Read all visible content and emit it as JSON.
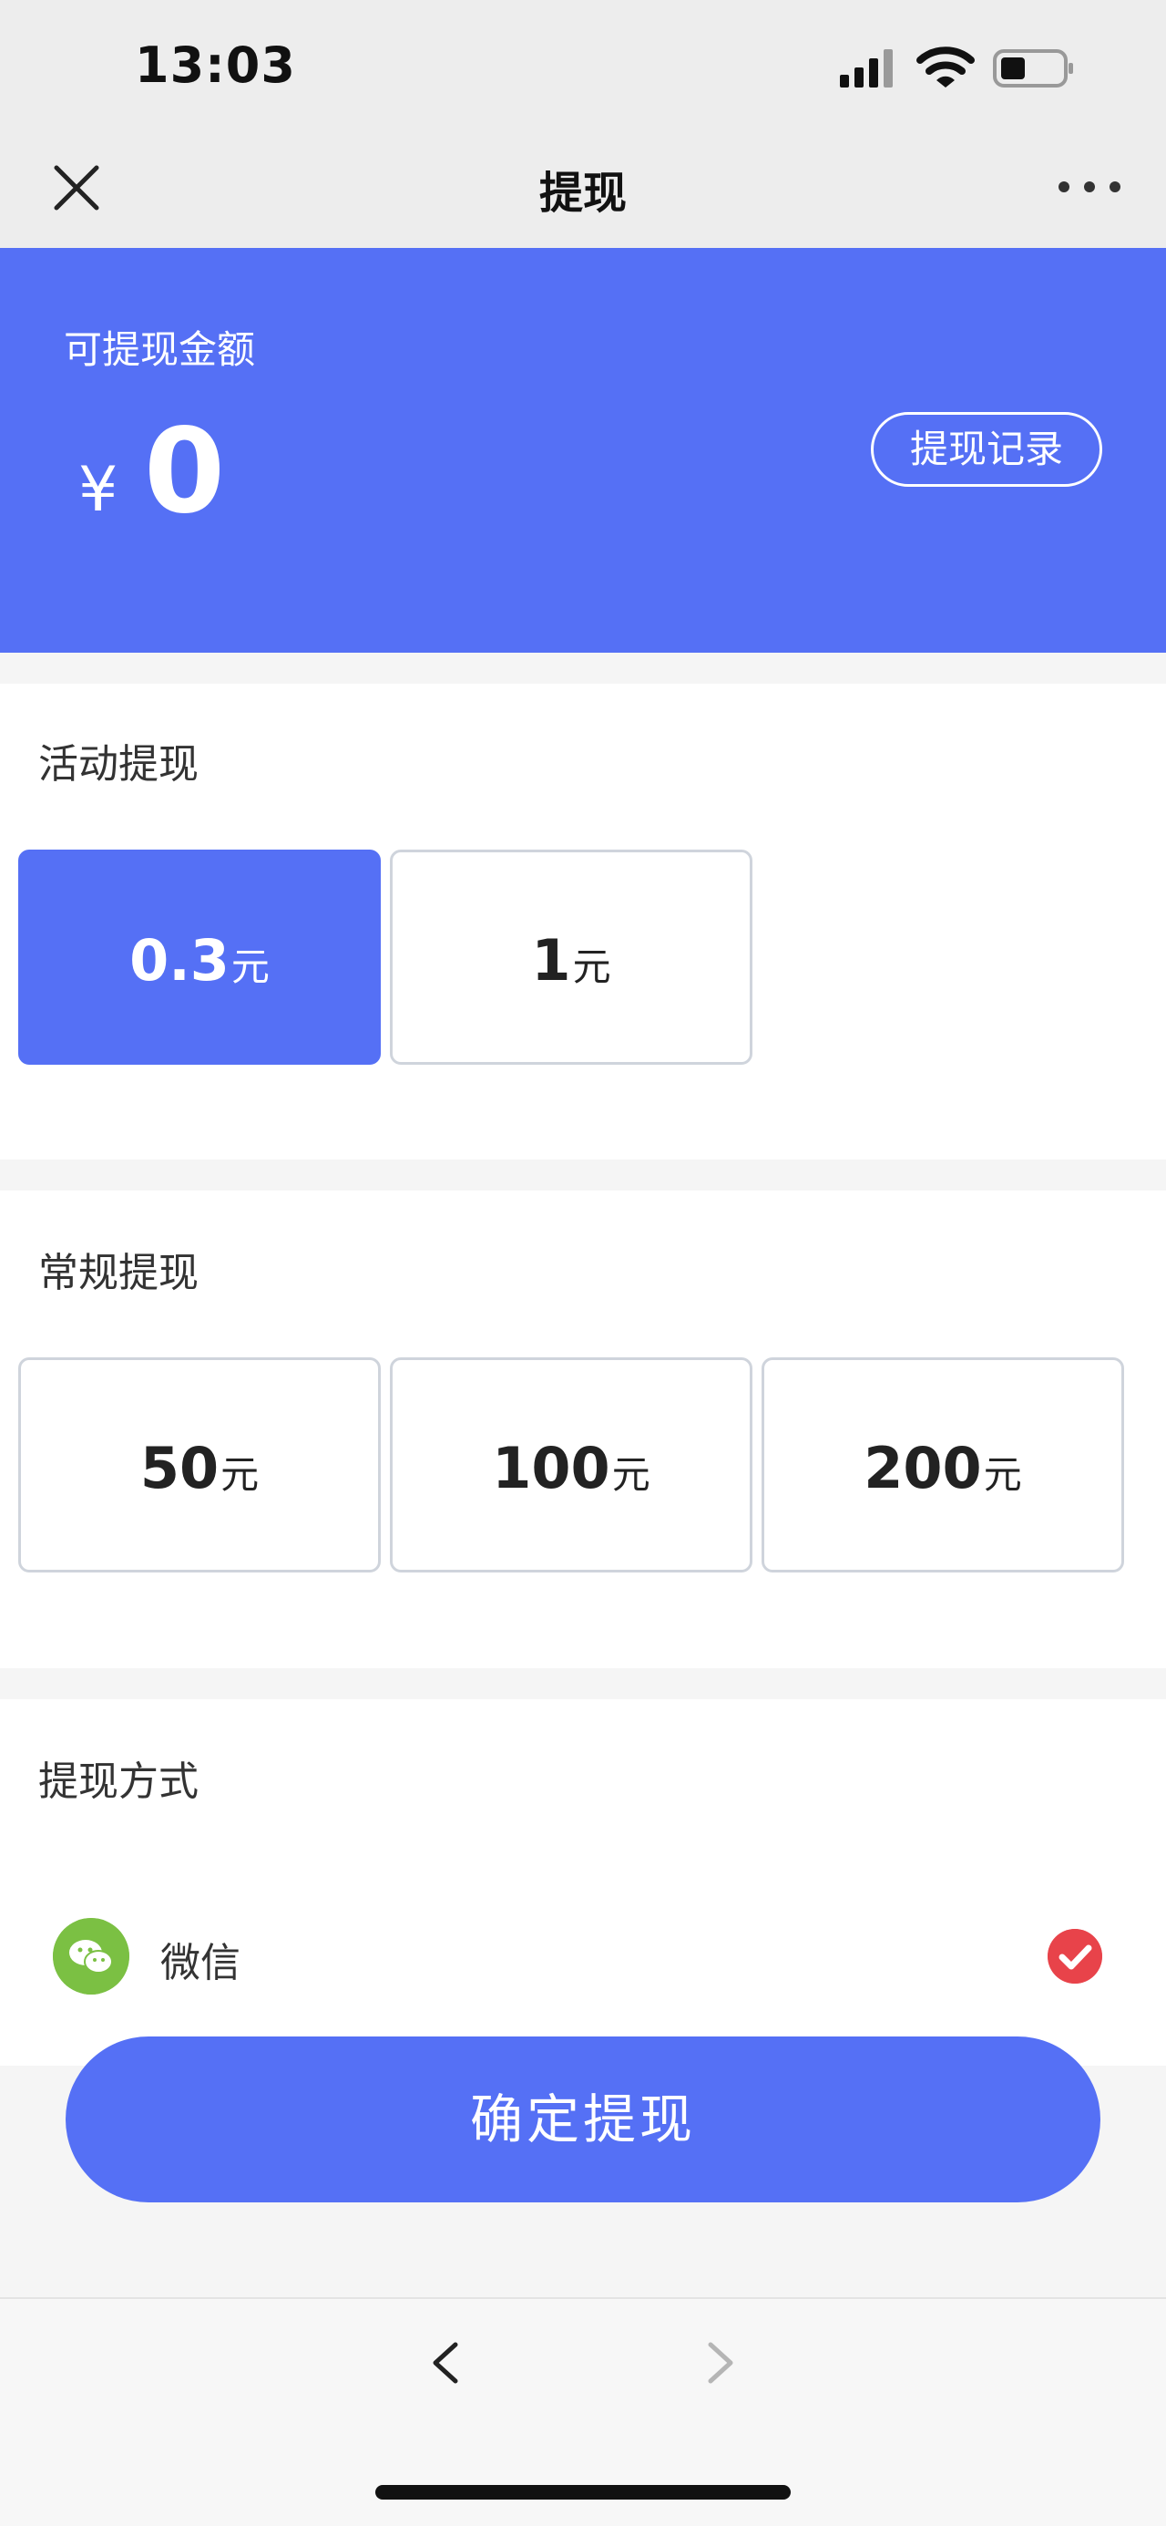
{
  "status_bar": {
    "time": "13:03"
  },
  "nav": {
    "title": "提现"
  },
  "balance": {
    "label": "可提现金额",
    "currency": "¥",
    "amount": "0",
    "record_button": "提现记录"
  },
  "activity": {
    "title": "活动提现",
    "options": [
      {
        "value": "0.3",
        "unit": "元",
        "selected": true
      },
      {
        "value": "1",
        "unit": "元",
        "selected": false
      }
    ]
  },
  "regular": {
    "title": "常规提现",
    "options": [
      {
        "value": "50",
        "unit": "元"
      },
      {
        "value": "100",
        "unit": "元"
      },
      {
        "value": "200",
        "unit": "元"
      }
    ]
  },
  "method": {
    "title": "提现方式",
    "option": "微信",
    "selected": true
  },
  "confirm_button": "确定提现",
  "colors": {
    "accent": "#5570f5",
    "check": "#e8434a",
    "wechat": "#7bc043"
  }
}
